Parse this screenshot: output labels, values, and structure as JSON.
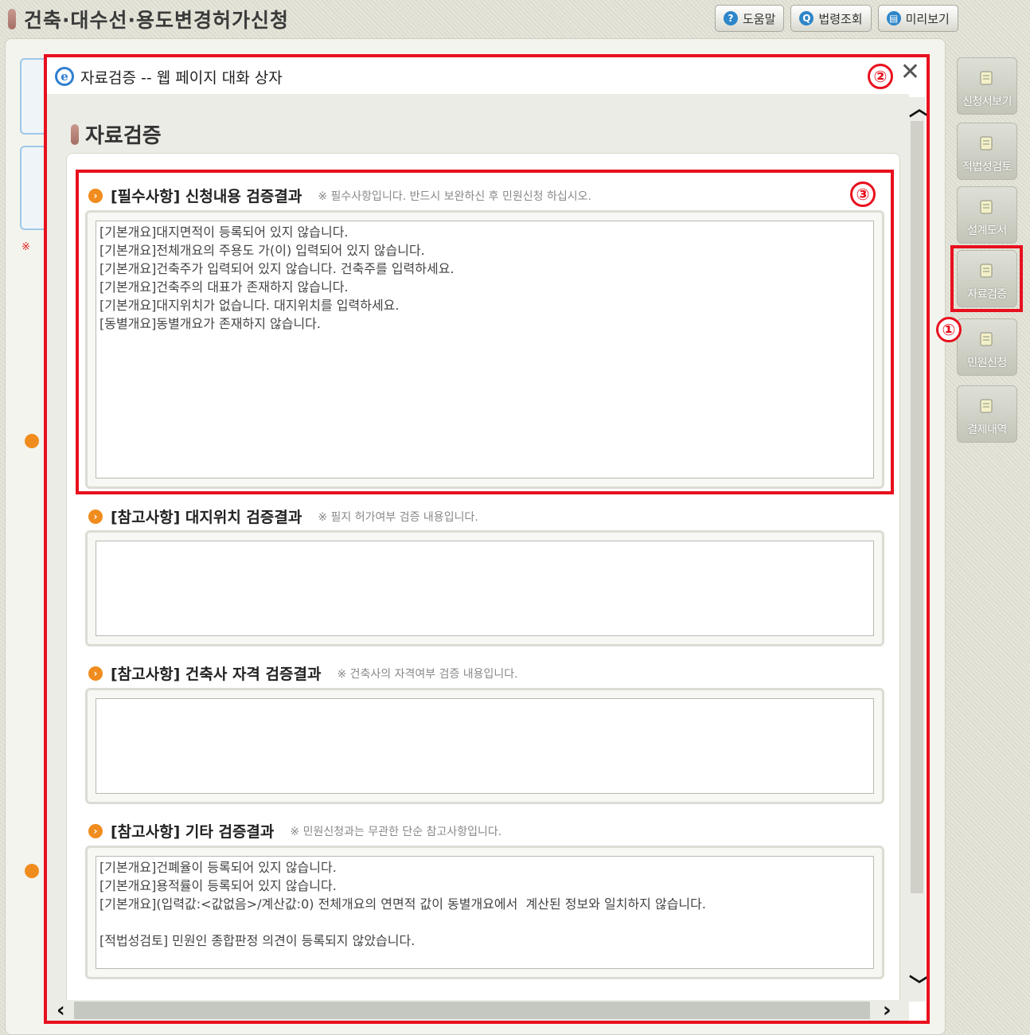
{
  "header": {
    "title": "건축·대수선·용도변경허가신청",
    "buttons": [
      {
        "label": "도움말",
        "icon": "help-icon"
      },
      {
        "label": "법령조회",
        "icon": "search-icon"
      },
      {
        "label": "미리보기",
        "icon": "preview-icon"
      }
    ]
  },
  "side_nav": {
    "items": [
      {
        "label": "신청서보기"
      },
      {
        "label": "적법성검토"
      },
      {
        "label": "설계도서"
      },
      {
        "label": "자료검증"
      },
      {
        "label": "민원신청"
      },
      {
        "label": "결제내역"
      }
    ]
  },
  "annotations": {
    "one": "①",
    "two": "②",
    "three": "③"
  },
  "dialog": {
    "window_title": "자료검증 -- 웹 페이지 대화 상자",
    "close_glyph": "✕",
    "section_title": "자료검증",
    "blocks": [
      {
        "label": "[필수사항] 신청내용 검증결과",
        "note": "※ 필수사항입니다. 반드시 보완하신 후 민원신청 하십시오.",
        "lines": [
          "[기본개요]대지면적이 등록되어 있지 않습니다.",
          "[기본개요]전체개요의 주용도 가(이) 입력되어 있지 않습니다.",
          "[기본개요]건축주가 입력되어 있지 않습니다. 건축주를 입력하세요.",
          "[기본개요]건축주의 대표가 존재하지 않습니다.",
          "[기본개요]대지위치가 없습니다. 대지위치를 입력하세요.",
          "[동별개요]동별개요가 존재하지 않습니다."
        ]
      },
      {
        "label": "[참고사항] 대지위치 검증결과",
        "note": "※ 필지 허가여부 검증 내용입니다.",
        "lines": []
      },
      {
        "label": "[참고사항] 건축사 자격 검증결과",
        "note": "※ 건축사의 자격여부 검증 내용입니다.",
        "lines": []
      },
      {
        "label": "[참고사항] 기타 검증결과",
        "note": "※ 민원신청과는 무관한 단순 참고사항입니다.",
        "lines": [
          "[기본개요]건폐율이 등록되어 있지 않습니다.",
          "[기본개요]용적률이 등록되어 있지 않습니다.",
          "[기본개요](입력값:<값없음>/계산값:0) 전체개요의 연면적 값이 동별개요에서  계산된 정보와 일치하지 않습니다.",
          "",
          "[적법성검토] 민원인 종합판정 의견이 등록되지 않았습니다."
        ]
      }
    ]
  },
  "colors": {
    "callout": "#e8101e",
    "accent": "#f08c1e"
  }
}
